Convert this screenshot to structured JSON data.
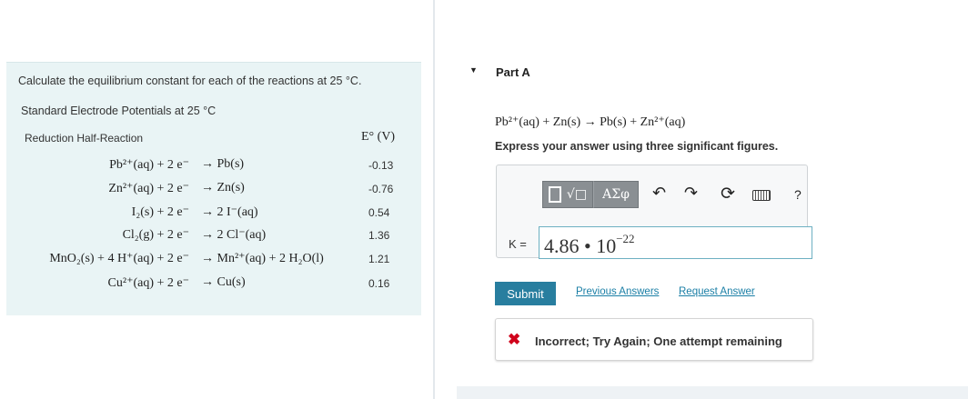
{
  "problem": {
    "intro": "Calculate the equilibrium constant for each of the reactions at 25 °C.",
    "table_title": "Standard Electrode Potentials at 25 °C",
    "col_reaction": "Reduction Half-Reaction",
    "col_potential": "E° (V)",
    "rows": [
      {
        "lhs": "Pb²⁺(aq) + 2 e⁻",
        "rhs": "→ Pb(s)",
        "e": "-0.13"
      },
      {
        "lhs": "Zn²⁺(aq) + 2 e⁻",
        "rhs": "→ Zn(s)",
        "e": "-0.76"
      },
      {
        "lhs": "I₂(s) + 2 e⁻",
        "rhs": "→ 2 I⁻(aq)",
        "e": "0.54"
      },
      {
        "lhs": "Cl₂(g) + 2 e⁻",
        "rhs": "→ 2 Cl⁻(aq)",
        "e": "1.36"
      },
      {
        "lhs": "MnO₂(s) + 4 H⁺(aq) + 2 e⁻",
        "rhs": "→ Mn²⁺(aq) + 2 H₂O(l)",
        "e": "1.21"
      },
      {
        "lhs": "Cu²⁺(aq) + 2 e⁻",
        "rhs": "→ Cu(s)",
        "e": "0.16"
      }
    ]
  },
  "part": {
    "toggle_icon": "▼",
    "title": "Part A",
    "reaction": "Pb²⁺(aq) + Zn(s) → Pb(s) + Zn²⁺(aq)",
    "instruction": "Express your answer using three significant figures."
  },
  "toolbar": {
    "templates_icon": "√□",
    "symbols_label": "ΑΣφ",
    "undo_icon": "undo-icon",
    "redo_icon": "redo-icon",
    "reset_icon": "reset-icon",
    "keyboard_icon": "keyboard-icon",
    "help_label": "?"
  },
  "answer": {
    "label": "K =",
    "mantissa": "4.86",
    "operator": "•",
    "base": "10",
    "exponent": "−22"
  },
  "actions": {
    "submit": "Submit",
    "previous_answers": "Previous Answers",
    "request_answer": "Request Answer"
  },
  "feedback": {
    "icon": "✖",
    "message": "Incorrect; Try Again; One attempt remaining",
    "icon_color": "#d0021b"
  },
  "colors": {
    "panel_bg": "#e9f4f5",
    "submit_bg": "#287e9f",
    "link": "#1b7fa6"
  }
}
